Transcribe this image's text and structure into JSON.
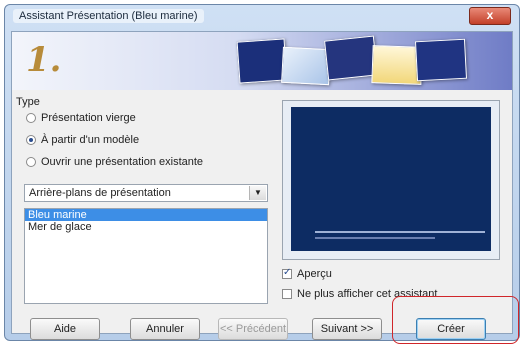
{
  "window": {
    "title": "Assistant Présentation (Bleu marine)",
    "close_glyph": "x"
  },
  "banner": {
    "step_number": "1."
  },
  "type_group": {
    "label": "Type",
    "options": [
      {
        "label": "Présentation vierge",
        "checked": false
      },
      {
        "label": "À partir d'un modèle",
        "checked": true
      },
      {
        "label": "Ouvrir une présentation existante",
        "checked": false
      }
    ]
  },
  "template_category": {
    "value": "Arrière-plans de présentation"
  },
  "templates": {
    "items": [
      {
        "label": "Bleu marine",
        "selected": true
      },
      {
        "label": "Mer de glace",
        "selected": false
      }
    ]
  },
  "options": {
    "preview_label": "Aperçu",
    "preview_checked": true,
    "dont_show_label": "Ne plus afficher cet assistant",
    "dont_show_checked": false
  },
  "buttons": {
    "help": "Aide",
    "cancel": "Annuler",
    "previous": "<< Précédent",
    "next": "Suivant >>",
    "create": "Créer"
  }
}
